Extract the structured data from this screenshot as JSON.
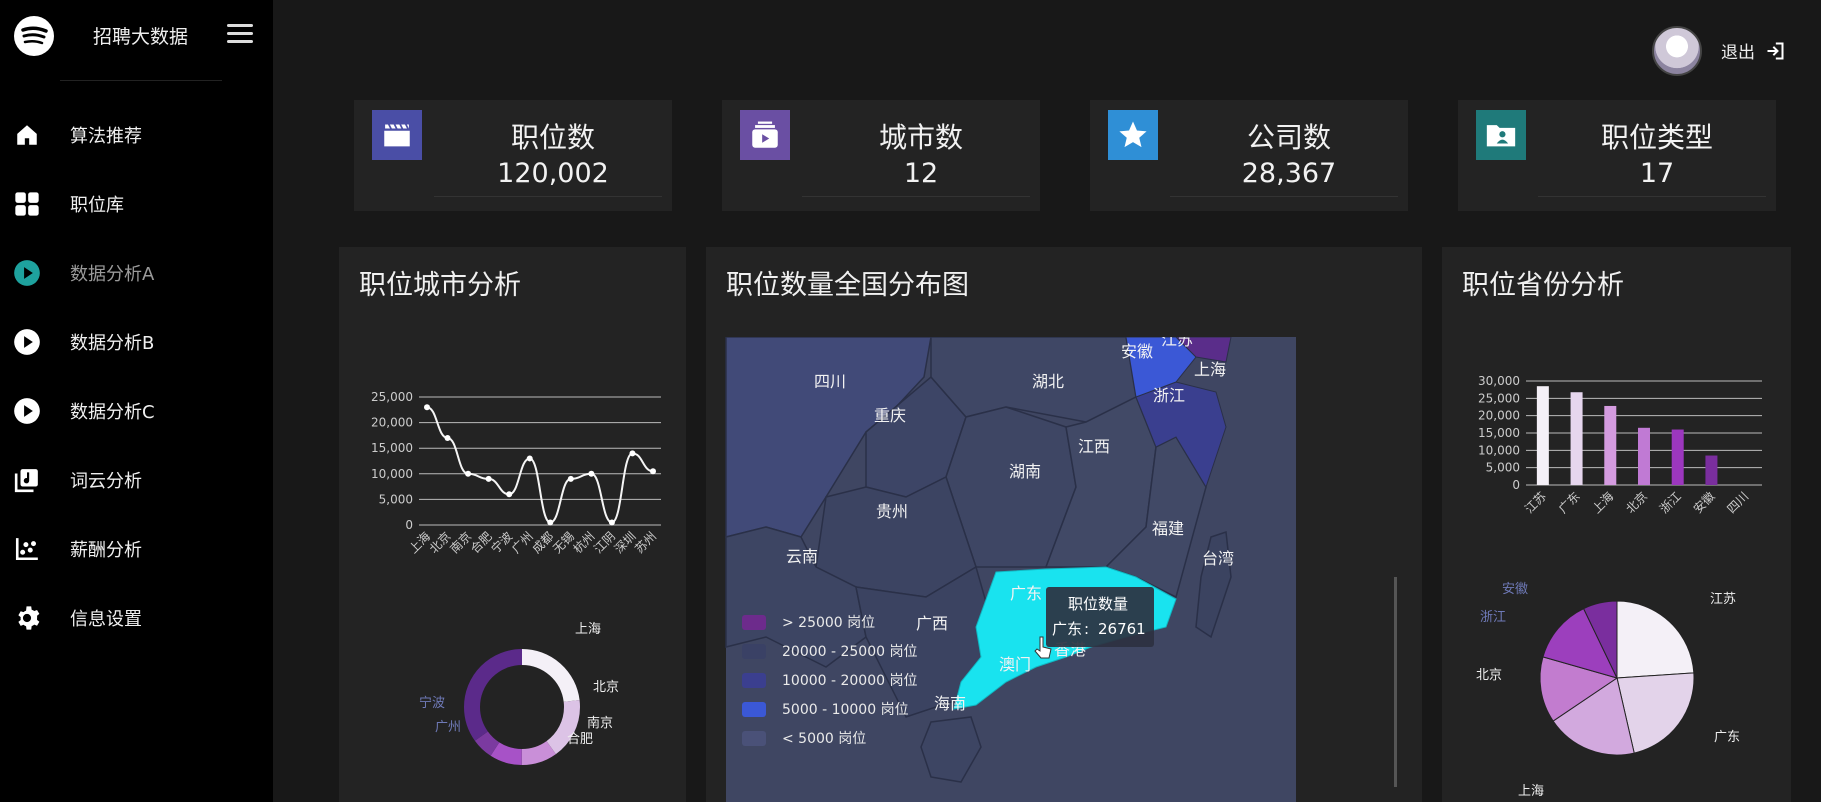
{
  "app": {
    "title": "招聘大数据"
  },
  "sidebar": {
    "items": [
      {
        "label": "算法推荐",
        "icon": "home-icon"
      },
      {
        "label": "职位库",
        "icon": "grid-icon"
      },
      {
        "label": "数据分析A",
        "icon": "play-circle-icon"
      },
      {
        "label": "数据分析B",
        "icon": "play-circle-icon"
      },
      {
        "label": "数据分析C",
        "icon": "play-circle-icon"
      },
      {
        "label": "词云分析",
        "icon": "music-library-icon"
      },
      {
        "label": "薪酬分析",
        "icon": "scatter-chart-icon"
      },
      {
        "label": "信息设置",
        "icon": "gear-icon"
      }
    ],
    "active_index": 2
  },
  "header": {
    "logout_label": "退出"
  },
  "stats": [
    {
      "title": "职位数",
      "value": "120,002",
      "icon": "clapperboard-icon",
      "color": "#4a4ea6"
    },
    {
      "title": "城市数",
      "value": "12",
      "icon": "video-library-icon",
      "color": "#6a4fa3"
    },
    {
      "title": "公司数",
      "value": "28,367",
      "icon": "star-icon",
      "color": "#2f8fd6"
    },
    {
      "title": "职位类型",
      "value": "17",
      "icon": "user-folder-icon",
      "color": "#1f7a7a"
    }
  ],
  "panels": {
    "city": {
      "title": "职位城市分析"
    },
    "map": {
      "title": "职位数量全国分布图"
    },
    "province": {
      "title": "职位省份分析"
    }
  },
  "chart_data": [
    {
      "type": "line",
      "categories": [
        "上海",
        "北京",
        "南京",
        "合肥",
        "宁波",
        "广州",
        "成都",
        "无锡",
        "杭州",
        "江阴",
        "深圳",
        "苏州"
      ],
      "values": [
        23000,
        17000,
        10000,
        9000,
        6000,
        13000,
        500,
        9000,
        10000,
        500,
        14000,
        10500
      ],
      "ylim": [
        0,
        25000
      ],
      "yticks": [
        "0",
        "5,000",
        "10,000",
        "15,000",
        "20,000",
        "25,000"
      ],
      "grid": true
    },
    {
      "type": "pie",
      "style": "donut",
      "labels": [
        "上海",
        "北京",
        "南京",
        "合肥",
        "宁波",
        "广州"
      ],
      "values": [
        23,
        17,
        10,
        9,
        6,
        35
      ],
      "colors": [
        "#f4f0f7",
        "#dcc3e6",
        "#c98fd8",
        "#a752c7",
        "#7b3aa0",
        "#5b2a8a"
      ]
    },
    {
      "type": "map",
      "tooltip": {
        "title": "职位数量",
        "label": "广东",
        "value": "26761"
      },
      "regions": [
        {
          "name": "广东",
          "value": 26761
        },
        {
          "name": "安徽"
        },
        {
          "name": "江苏"
        },
        {
          "name": "上海"
        },
        {
          "name": "浙江"
        }
      ],
      "place_labels": [
        "四川",
        "重庆",
        "湖北",
        "湖南",
        "江西",
        "贵州",
        "云南",
        "广西",
        "广东",
        "香港",
        "澳门",
        "海南",
        "福建",
        "台湾",
        "浙江",
        "上海",
        "安徽",
        "江苏"
      ],
      "legend": [
        {
          "label": "> 25000 岗位",
          "color": "#6d2b8c"
        },
        {
          "label": "20000 - 25000 岗位",
          "color": "#3a4165"
        },
        {
          "label": "10000 - 20000 岗位",
          "color": "#3b3f8f"
        },
        {
          "label": "5000 - 10000 岗位",
          "color": "#3b58d6"
        },
        {
          "label": "< 5000 岗位",
          "color": "#4a5178"
        }
      ]
    },
    {
      "type": "bar",
      "categories": [
        "江苏",
        "广东",
        "上海",
        "北京",
        "浙江",
        "安徽",
        "四川"
      ],
      "values": [
        28500,
        26761,
        22800,
        16500,
        16000,
        8500,
        0
      ],
      "ylim": [
        0,
        30000
      ],
      "yticks": [
        "0",
        "5,000",
        "10,000",
        "15,000",
        "20,000",
        "25,000",
        "30,000"
      ],
      "colors": [
        "#f4f0f7",
        "#e6d6ee",
        "#d49bdf",
        "#c07ad4",
        "#9c37be",
        "#7a2e9e",
        "#5b2a8a"
      ],
      "grid": true
    },
    {
      "type": "pie",
      "labels": [
        "江苏",
        "广东",
        "上海",
        "北京",
        "浙江",
        "安徽"
      ],
      "values": [
        28500,
        26761,
        22800,
        16500,
        16000,
        8500
      ],
      "colors": [
        "#f4f0f7",
        "#e3d3ea",
        "#d2a9de",
        "#c27ccf",
        "#9c3fbd",
        "#7a2e9e"
      ]
    }
  ]
}
